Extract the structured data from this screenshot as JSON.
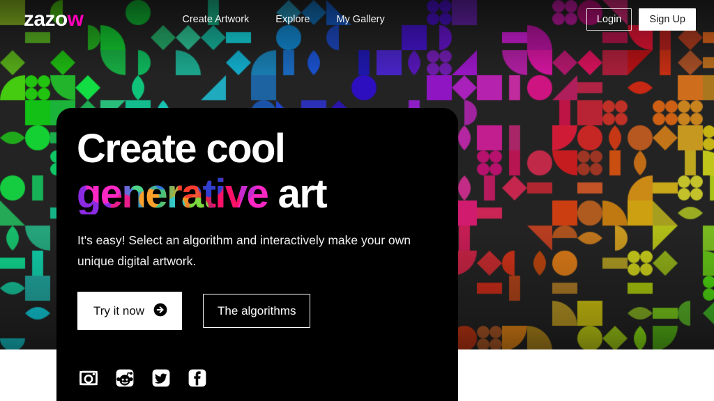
{
  "site": {
    "logo_main": "zazo",
    "logo_accent": "w"
  },
  "header": {
    "nav": [
      {
        "label": "Create Artwork",
        "name": "nav-create-artwork"
      },
      {
        "label": "Explore",
        "name": "nav-explore"
      },
      {
        "label": "My Gallery",
        "name": "nav-my-gallery"
      }
    ],
    "login_label": "Login",
    "signup_label": "Sign Up"
  },
  "hero": {
    "headline_line1": "Create cool",
    "headline_gen_word": "generative",
    "headline_line2_rest": "art",
    "subtitle": "It's easy! Select an algorithm and interactively make your own unique digital artwork.",
    "primary_cta": "Try it now",
    "primary_cta_icon": "arrow-right-circle-icon",
    "secondary_cta": "The algorithms",
    "social": [
      {
        "name": "instagram-icon",
        "label": "Instagram"
      },
      {
        "name": "reddit-icon",
        "label": "Reddit"
      },
      {
        "name": "twitter-icon",
        "label": "Twitter"
      },
      {
        "name": "facebook-icon",
        "label": "Facebook"
      }
    ]
  },
  "colors": {
    "accent_magenta": "#ff00b8",
    "hero_card_bg": "#000000",
    "pattern_bg": "#262626",
    "page_bg": "#ffffff"
  },
  "pattern": {
    "cell": 36,
    "cols": 29,
    "rows": 14,
    "shapes": [
      "square",
      "circle",
      "triangle",
      "diamond",
      "lens",
      "quarter",
      "quad-circles",
      "half-circle",
      "bar"
    ]
  }
}
